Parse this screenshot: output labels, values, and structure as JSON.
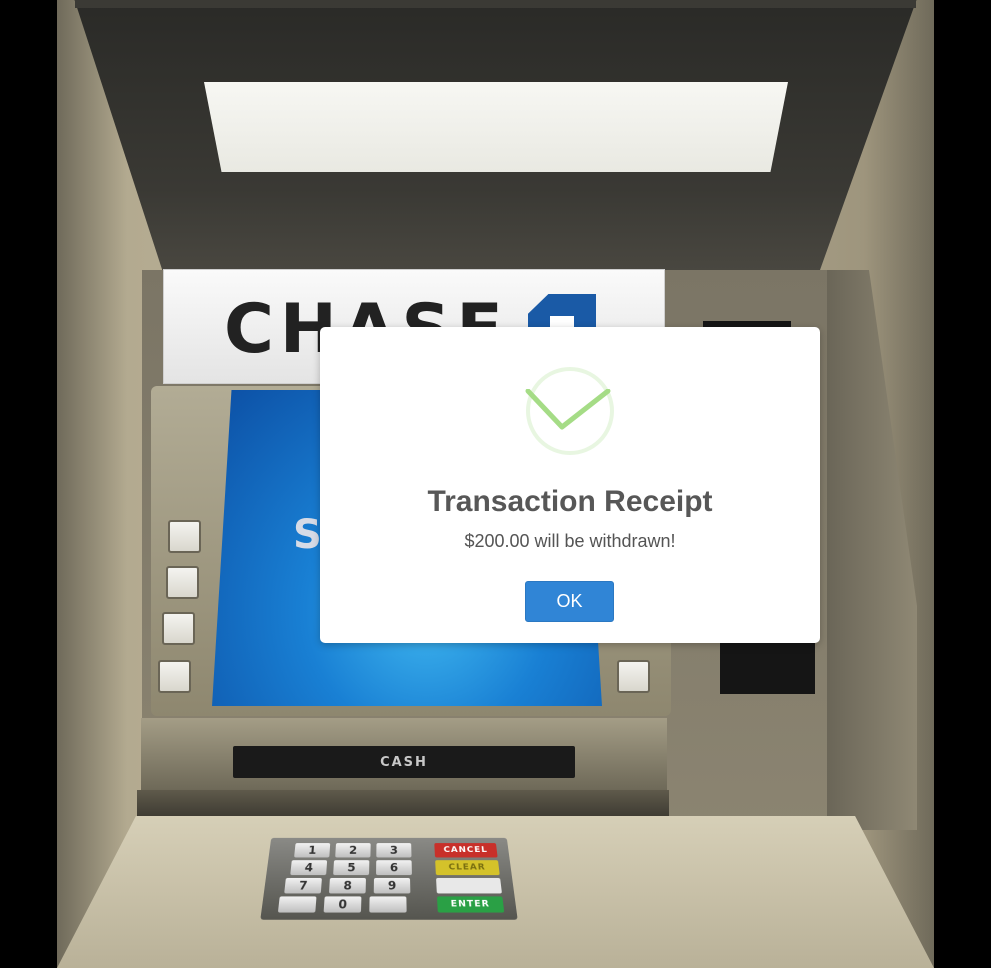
{
  "atm": {
    "brand": "CHASE",
    "screen_partial_text": "S",
    "cash_slot_label": "CASH",
    "keypad": {
      "digits": [
        "1",
        "2",
        "3",
        "4",
        "5",
        "6",
        "7",
        "8",
        "9",
        "0"
      ],
      "function_keys": [
        "CANCEL",
        "CLEAR",
        "",
        "ENTER"
      ]
    }
  },
  "dialog": {
    "icon": "success-check-icon",
    "title": "Transaction Receipt",
    "message": "$200.00 will be withdrawn!",
    "ok_label": "OK"
  },
  "colors": {
    "accent": "#3085d6",
    "success": "#a5dc86"
  }
}
